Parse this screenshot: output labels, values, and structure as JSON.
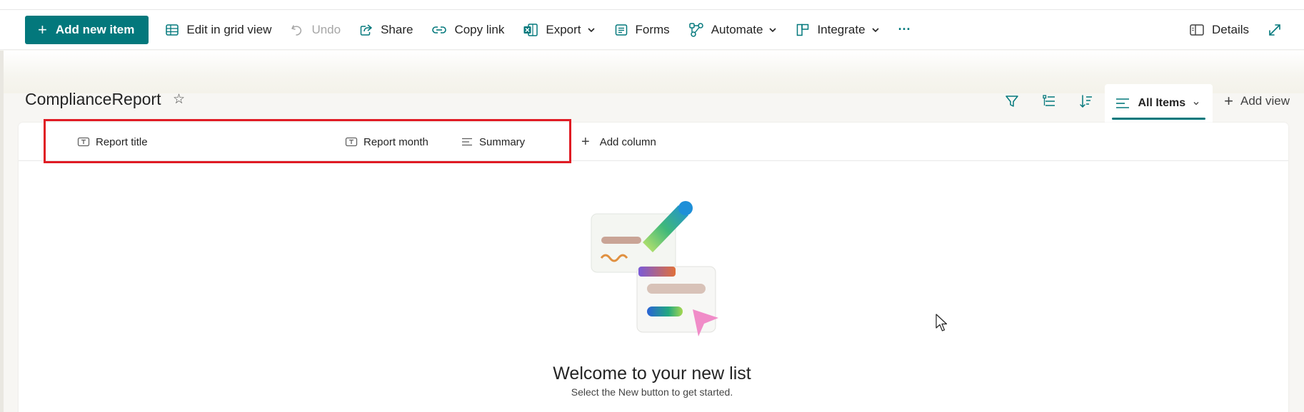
{
  "commandbar": {
    "add_new_item": "Add new item",
    "edit_grid": "Edit in grid view",
    "undo": "Undo",
    "share": "Share",
    "copy_link": "Copy link",
    "export": "Export",
    "forms": "Forms",
    "automate": "Automate",
    "integrate": "Integrate",
    "more": "···",
    "details": "Details"
  },
  "list": {
    "title": "ComplianceReport",
    "view_name": "All Items",
    "add_view": "Add view"
  },
  "columns": [
    {
      "label": "Report title",
      "icon": "text-column-icon"
    },
    {
      "label": "Report month",
      "icon": "text-column-icon"
    },
    {
      "label": "Summary",
      "icon": "multiline-text-icon"
    }
  ],
  "add_column": "Add column",
  "empty_state": {
    "title": "Welcome to your new list",
    "subtitle": "Select the New button to get started."
  },
  "colors": {
    "accent": "#03787c",
    "highlight_box": "#e01b24"
  }
}
